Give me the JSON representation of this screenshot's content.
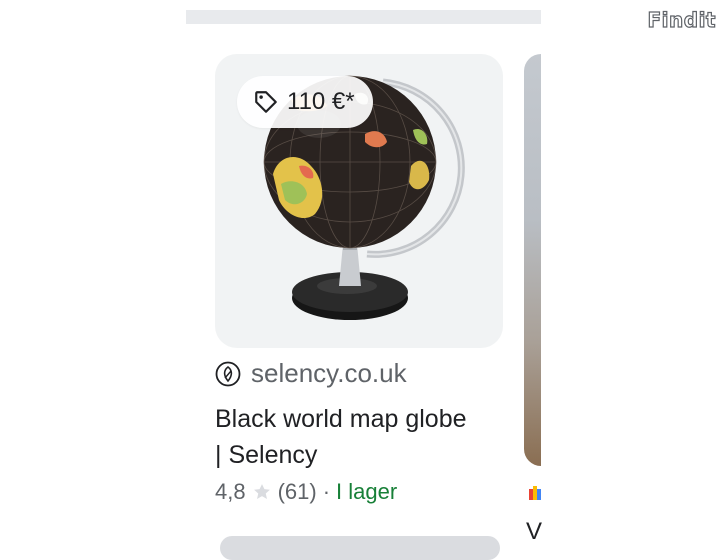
{
  "watermark": "Findit",
  "card": {
    "price": "110 €*",
    "source": "selency.co.uk",
    "title_line1": "Black world map globe",
    "title_line2": "| Selency",
    "rating": "4,8",
    "reviews": "(61)",
    "separator": "·",
    "stock": "I lager",
    "rating_fraction": 0.96
  },
  "next_card": {
    "title_initial": "V"
  },
  "colors": {
    "stock_green": "#188038",
    "secondary_text": "#5f6368",
    "chip_bg": "#ffffff",
    "card_bg": "#f1f3f4"
  }
}
